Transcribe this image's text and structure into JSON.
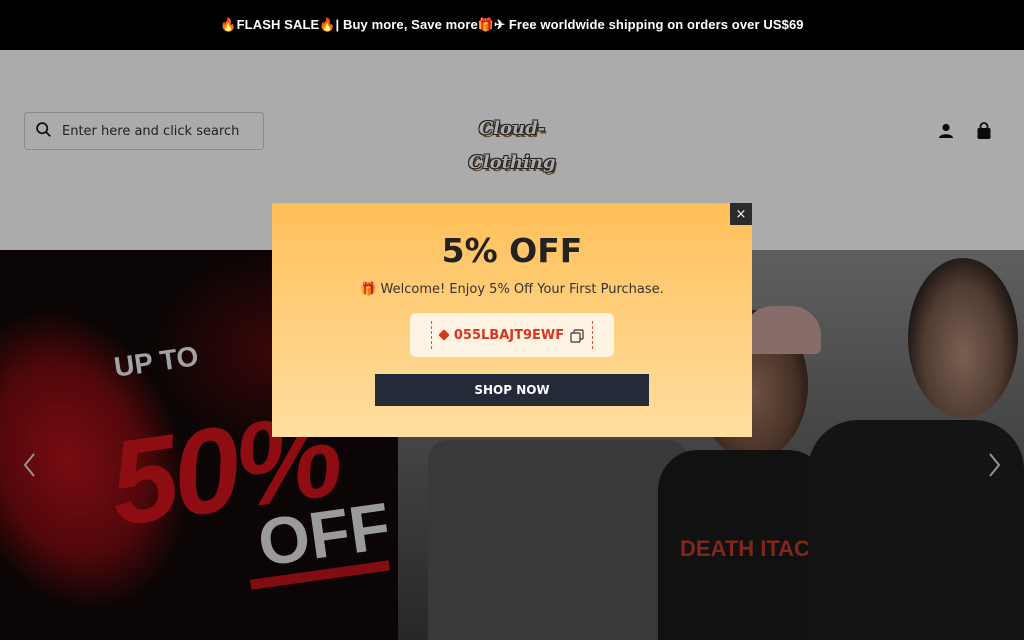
{
  "announcement": {
    "text": "🔥FLASH SALE🔥| Buy more, Save more🎁✈ Free worldwide shipping on orders over US$69"
  },
  "header": {
    "search_placeholder": "Enter here and click search",
    "logo_text": "Cloud-Clothing",
    "icons": [
      "search-icon",
      "account-icon",
      "cart-icon"
    ]
  },
  "hero": {
    "left_banner": {
      "upto": "UP TO",
      "percent": "50%",
      "off": "OFF"
    },
    "tee_print": "DEATH ITACH",
    "arrows": [
      "chevron-left-icon",
      "chevron-right-icon"
    ]
  },
  "popup": {
    "title": "5% OFF",
    "subtitle": "🎁 Welcome! Enjoy 5% Off Your First Purchase.",
    "coupon_code": "055LBAJT9EWF",
    "cta_label": "SHOP NOW",
    "close_label": "×"
  },
  "colors": {
    "popup_gradient_top": "#ffbf58",
    "popup_gradient_bottom": "#ffdea0",
    "coupon_text": "#d9361f",
    "cta_bg": "#242a38",
    "announcement_bg": "#000000"
  }
}
